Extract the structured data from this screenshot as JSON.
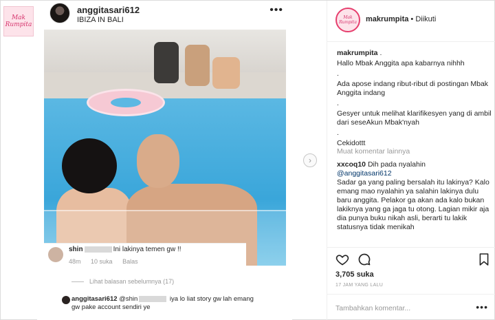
{
  "poster": {
    "avatar_logo": "Mak Rumpita",
    "avatar_icon": "makrumpita-logo"
  },
  "card": {
    "username": "anggitasari612",
    "location": "IBIZA IN BALI",
    "more": "•••",
    "comment": {
      "user_prefix": "shin",
      "text": "Ini lakinya temen gw !!",
      "age": "48m",
      "likes": "10 suka",
      "reply": "Balas"
    },
    "view_previous": "Lihat balasan sebelumnya (17)",
    "reply": {
      "user": "anggitasari612",
      "mention_prefix": "@shin",
      "text": "iya lo liat story gw lah emang gw pake account sendiri ye"
    }
  },
  "carousel": {
    "next_icon": "chevron-right-icon",
    "next_glyph": "›"
  },
  "post": {
    "username": "makrumpita",
    "separator": " • ",
    "follow_status": "Diikuti",
    "avatar_logo": "Mak Rumpita",
    "caption_user": "makrumpita",
    "caption_lines": [
      " .",
      "Hallo Mbak Anggita apa kabarnya nihhh",
      ".",
      "Ada apose indang ribut-ribut di postingan Mbak Anggita indang",
      ".",
      "Gesyer untuk melihat klarifikesyen yang di ambil dari seseAkun Mbak'nyah",
      ".",
      "Cekidottt"
    ],
    "load_more": "Muat komentar lainnya",
    "comment": {
      "user": "xxcoq10",
      "text_1": " Dih pada nyalahin",
      "mention": "@anggitasari612",
      "text_2": "Sadar ga yang paling bersalah itu lakinya? Kalo emang mao nyalahin ya salahin lakinya dulu baru anggita. Pelakor ga akan ada kalo bukan lakiknya yang ga jaga tu otong. Lagian mikir aja dia punya buku nikah asli, berarti tu lakik statusnya tidak menikah"
    },
    "likes": "3,705 suka",
    "time": "17 JAM YANG LALU",
    "comment_placeholder": "Tambahkan komentar...",
    "more": "•••",
    "icons": {
      "like": "heart-icon",
      "comment": "comment-bubble-icon",
      "save": "bookmark-icon"
    },
    "colors": {
      "accent": "#e63e6d",
      "link": "#003569",
      "muted": "#999999"
    }
  }
}
